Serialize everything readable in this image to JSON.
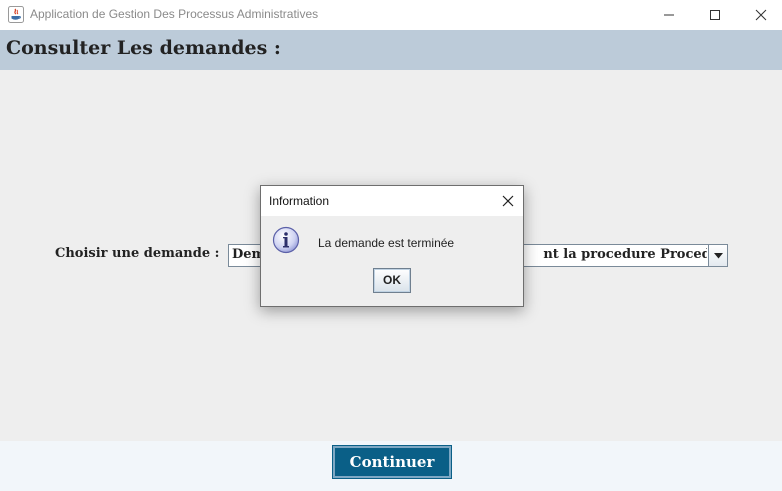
{
  "window": {
    "title": "Application de Gestion Des Processus Administratives",
    "controls": [
      "minimize-icon",
      "maximize-icon",
      "close-icon"
    ]
  },
  "header": {
    "title": "Consulter Les demandes :"
  },
  "form": {
    "choose_label": "Choisir une demande :",
    "selected_demande_visible_start": "Dem",
    "selected_demande_visible_end": "nt la procedure Procedur..."
  },
  "footer": {
    "continue_label": "Continuer"
  },
  "dialog": {
    "title": "Information",
    "icon": "info-icon",
    "message": "La demande est terminée",
    "ok_label": "OK"
  },
  "colors": {
    "header_band": "#bccbd9",
    "continue_button": "#0a5f87",
    "content_background": "#eeeeee"
  }
}
